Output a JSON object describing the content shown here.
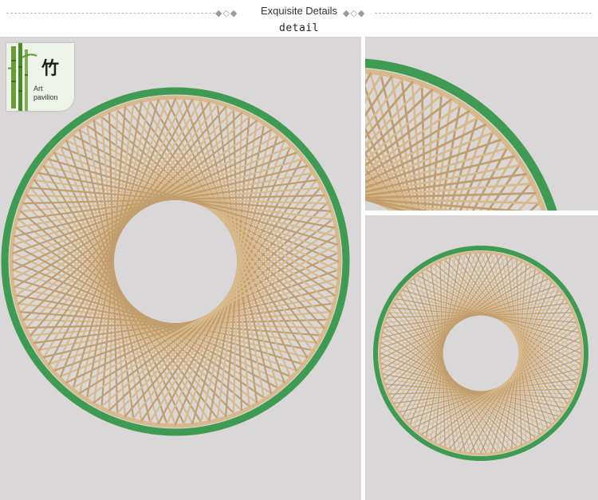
{
  "header": {
    "title": "Exquisite Details",
    "subtitle": "detail",
    "diamonds_left": "◆◇◆",
    "diamonds_right": "◆◇◆"
  },
  "badge": {
    "glyph": "竹",
    "line1": "Art",
    "line2": "pavilion"
  },
  "colors": {
    "bamboo": "#d7b98c",
    "bamboo_dark": "#c29e6d",
    "rim_green": "#3f9a52",
    "background": "#d9d7d8"
  }
}
